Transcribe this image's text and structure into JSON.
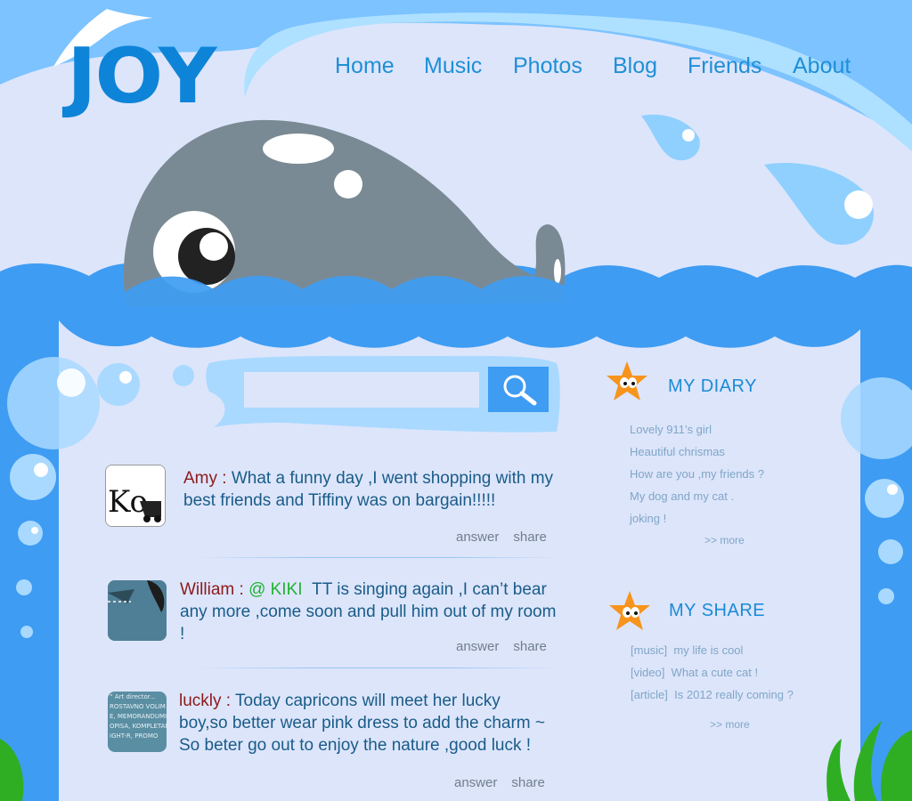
{
  "brand": {
    "logo_text": "JOY"
  },
  "nav": {
    "items": [
      {
        "label": "Home"
      },
      {
        "label": "Music"
      },
      {
        "label": "Photos"
      },
      {
        "label": "Blog"
      },
      {
        "label": "Friends"
      },
      {
        "label": "About"
      }
    ]
  },
  "search": {
    "placeholder": "",
    "value": ""
  },
  "posts": [
    {
      "author": "Amy",
      "separator": " : ",
      "mention": "",
      "text": "What a funny day ,I went shopping with my best friends and Tiffiny was on bargain!!!!!",
      "answer_label": "answer",
      "share_label": "share"
    },
    {
      "author": "William",
      "separator": " : ",
      "mention": "@ KIKI",
      "text": "TT is singing again ,I can’t bear any more ,come soon and pull him out of my room !",
      "answer_label": "answer",
      "share_label": "share"
    },
    {
      "author": "luckly",
      "separator": " : ",
      "mention": "",
      "text": "Today capricons will meet her lucky boy,so better wear pink dress to  add the charm ~ So beter go out to enjoy the nature ,good luck !",
      "answer_label": "answer",
      "share_label": "share"
    }
  ],
  "sidebar": {
    "diary": {
      "title": "MY DIARY",
      "items": [
        "Lovely 911’s girl",
        "Heautiful chrismas",
        "How are you ,my friends ?",
        "My dog and my cat .",
        "joking !"
      ],
      "more": ">> more"
    },
    "share": {
      "title": "MY SHARE",
      "items": [
        {
          "tag": "[music]",
          "text": "my life is cool"
        },
        {
          "tag": "[video]",
          "text": "What a cute cat !"
        },
        {
          "tag": "[article]",
          "text": "Is 2012 really coming ?"
        }
      ],
      "more": ">> more"
    }
  },
  "colors": {
    "sky": "#7cc3ff",
    "cloud": "#dde5fb",
    "water": "#3e9cf2",
    "link": "#1f8fd6",
    "author": "#8c1a1a",
    "mention": "#1fb232",
    "whale": "#7a8a94"
  },
  "avatars": {
    "post3_lines": [
      "“ Art director...",
      "ROSTAVNO VOLIM",
      "E, MEMORANDUMI",
      "OPISA, KOMPLETAN",
      "IGHT-R, PROMO"
    ]
  }
}
